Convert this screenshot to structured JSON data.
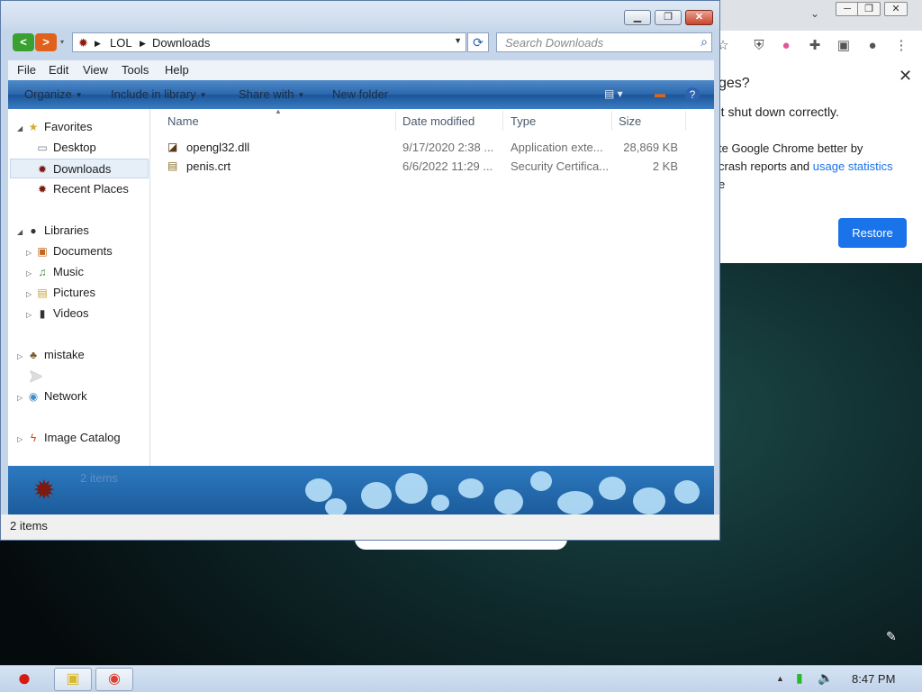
{
  "chrome": {
    "controls": [
      "─",
      "❐",
      "✕"
    ],
    "toolbar_icons": [
      "star-icon",
      "shield-icon",
      "extension-icon",
      "sidebar-icon",
      "profile-icon",
      "menu-icon"
    ],
    "panel": {
      "title": "ges?",
      "line1": "'t shut down correctly.",
      "line2": "te Google Chrome better by",
      "line3_prefix": "crash reports and ",
      "line3_link": "usage statistics",
      "line4": "e",
      "restore_label": "Restore"
    }
  },
  "explorer": {
    "window_controls": {
      "minimize": "▁",
      "maximize": "❐",
      "close": "✕"
    },
    "address": {
      "crumbs": [
        "LOL",
        "Downloads"
      ]
    },
    "search": {
      "placeholder": "Search Downloads"
    },
    "menu": [
      "File",
      "Edit",
      "View",
      "Tools",
      "Help"
    ],
    "commands": {
      "organize": "Organize",
      "include_in_library": "Include in library",
      "share_with": "Share with",
      "new_folder": "New folder"
    },
    "nav": {
      "favorites": "Favorites",
      "desktop": "Desktop",
      "downloads": "Downloads",
      "recent_places": "Recent Places",
      "libraries": "Libraries",
      "documents": "Documents",
      "music": "Music",
      "pictures": "Pictures",
      "videos": "Videos",
      "mistake": "mistake",
      "network": "Network",
      "image_catalog": "Image Catalog"
    },
    "columns": {
      "name": "Name",
      "date_modified": "Date modified",
      "type": "Type",
      "size": "Size"
    },
    "files": [
      {
        "name": "opengl32.dll",
        "date": "9/17/2020 2:38 ...",
        "type": "Application exte...",
        "size": "28,869 KB"
      },
      {
        "name": "penis.crt",
        "date": "6/6/2022 11:29 ...",
        "type": "Security Certifica...",
        "size": "2 KB"
      }
    ],
    "details_count": "2 items",
    "status": "2 items"
  },
  "taskbar": {
    "clock": "8:47 PM"
  }
}
